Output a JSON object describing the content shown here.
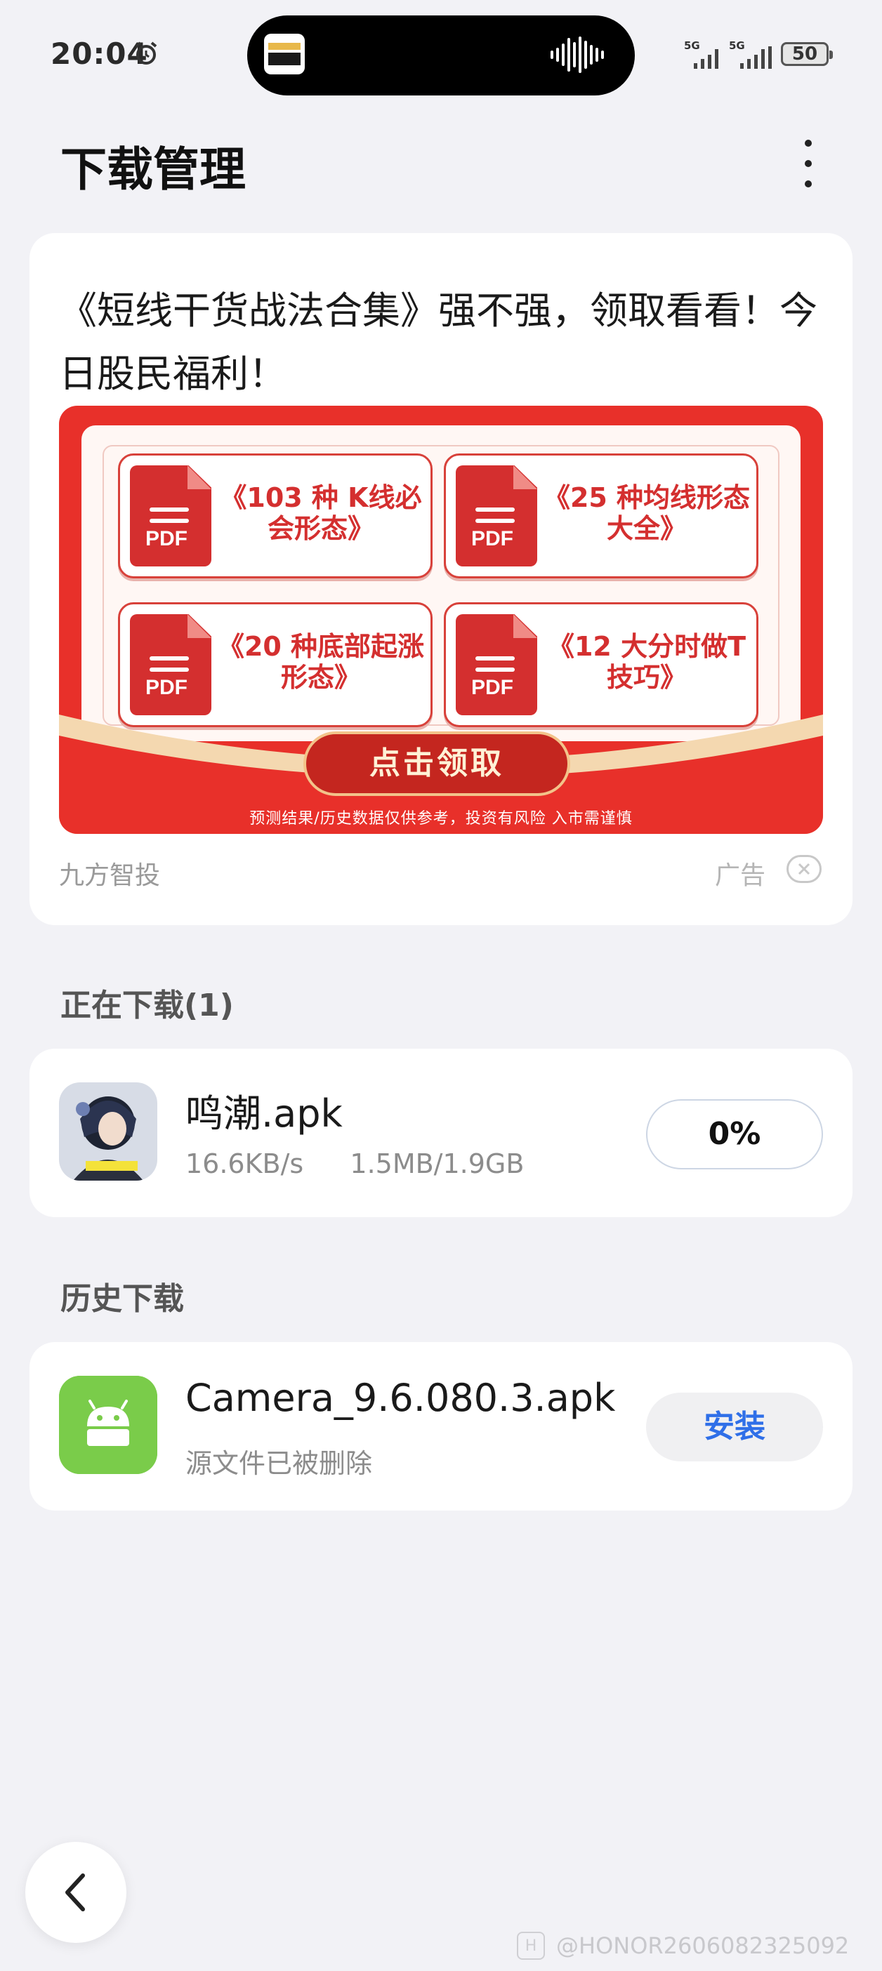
{
  "status_bar": {
    "time": "20:04",
    "signal1_label": "5G",
    "signal2_label": "5G",
    "battery": "50"
  },
  "header": {
    "title": "下载管理",
    "more_icon": "more-vertical-icon"
  },
  "ad": {
    "headline": "《短线干货战法合集》强不强，领取看看！今日股民福利！",
    "tiles": [
      {
        "label": "《103 种 K线必会形态》",
        "icon_text": "PDF"
      },
      {
        "label": "《25 种均线形态大全》",
        "icon_text": "PDF"
      },
      {
        "label": "《20 种底部起涨形态》",
        "icon_text": "PDF"
      },
      {
        "label": "《12 大分时做T 技巧》",
        "icon_text": "PDF"
      }
    ],
    "claim_button": "点击领取",
    "disclaimer": "预测结果/历史数据仅供参考，投资有风险 入市需谨慎",
    "source": "九方智投",
    "tag": "广告",
    "colors": {
      "banner_red": "#e8302a",
      "tile_red": "#d42f2f"
    }
  },
  "downloading": {
    "section_title": "正在下载(1)",
    "items": [
      {
        "name": "鸣潮.apk",
        "speed": "16.6KB/s",
        "size": "1.5MB/1.9GB",
        "progress_label": "0%",
        "progress": 0
      }
    ]
  },
  "history": {
    "section_title": "历史下载",
    "items": [
      {
        "name": "Camera_9.6.080.3.apk",
        "status": "源文件已被删除",
        "action": "安装"
      }
    ]
  },
  "footer": {
    "back_icon": "chevron-left-icon",
    "watermark": "@HONOR2606082325092"
  },
  "accent": "#2f6fe8"
}
